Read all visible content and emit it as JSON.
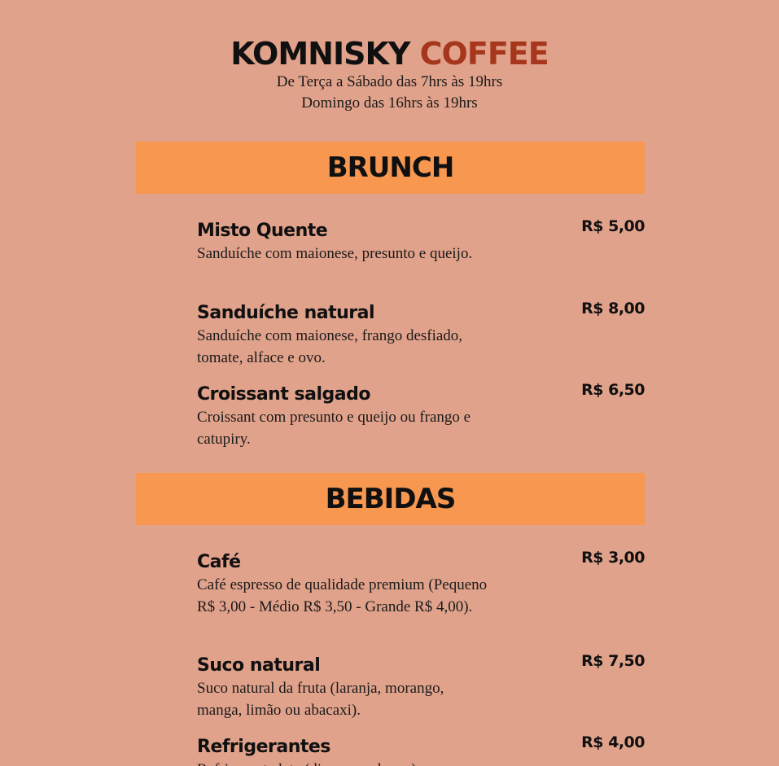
{
  "header": {
    "brand_part1": "KOMNISKY",
    "brand_part2": "COFFEE",
    "hours_line1": "De Terça a Sábado das 7hrs às 19hrs",
    "hours_line2": "Domingo das 16hrs às 19hrs"
  },
  "sections": [
    {
      "title": "BRUNCH",
      "items": [
        {
          "name": "Misto Quente",
          "price": "R$ 5,00",
          "desc": "Sanduíche com maionese, presunto e queijo."
        },
        {
          "name": "Sanduíche natural",
          "price": "R$ 8,00",
          "desc": "Sanduíche com maionese, frango desfiado, tomate, alface e ovo."
        },
        {
          "name": "Croissant salgado",
          "price": "R$ 6,50",
          "desc": "Croissant com presunto e queijo ou frango e catupiry."
        }
      ]
    },
    {
      "title": "BEBIDAS",
      "items": [
        {
          "name": "Café",
          "price": "R$ 3,00",
          "desc": "Café espresso de qualidade premium (Pequeno R$ 3,00 - Médio R$ 3,50 - Grande R$ 4,00)."
        },
        {
          "name": "Suco natural",
          "price": "R$ 7,50",
          "desc": "Suco natural da fruta (laranja, morango, manga, limão ou abacaxi)."
        },
        {
          "name": "Refrigerantes",
          "price": "R$ 4,00",
          "desc": "Refrigerante lata (diversos sabores)."
        }
      ]
    }
  ],
  "colors": {
    "background": "#e1a28b",
    "section_band": "#f79750",
    "brand_accent": "#a6361c"
  }
}
